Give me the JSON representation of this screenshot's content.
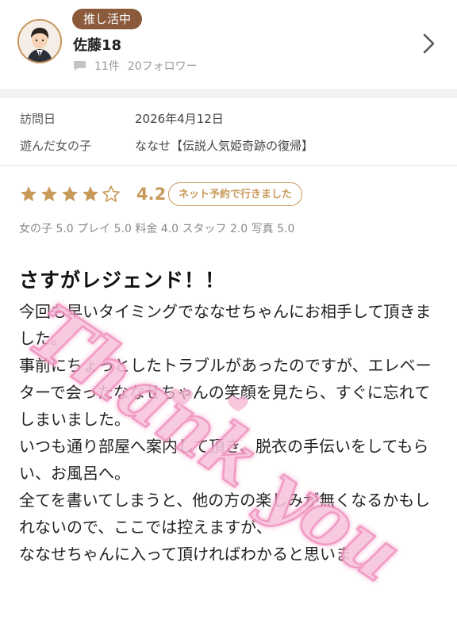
{
  "header": {
    "badge": "推し活中",
    "user_name": "佐藤18",
    "review_count": "11件",
    "followers": "20フォロワー"
  },
  "info": {
    "visit_label": "訪問日",
    "visit_date": "2026年4月12日",
    "girl_label": "遊んだ女の子",
    "girl_value": "ななせ【伝説人気姫奇跡の復帰】"
  },
  "rating": {
    "stars": 4,
    "max_stars": 5,
    "score": "4.2",
    "booking_badge": "ネット予約で行きました",
    "subscores": "女の子 5.0  プレイ 5.0  料金 4.0  スタッフ 2.0  写真 5.0"
  },
  "review": {
    "title": "さすがレジェンド！！",
    "paragraphs": [
      "今回も早いタイミングでななせちゃんにお相手して頂きました。",
      "事前にちょっとしたトラブルがあったのですが、エレベーターで会ったななせちゃんの笑顔を見たら、すぐに忘れてしまいました。",
      "いつも通り部屋へ案内して頂き、脱衣の手伝いをしてもらい、お風呂へ。",
      "全てを書いてしまうと、他の方の楽しみが無くなるかもしれないので、ここでは控えますが、",
      "ななせちゃんに入って頂ければわかると思いま"
    ]
  },
  "watermark": {
    "text": "Thank you"
  },
  "colors": {
    "accent": "#c89a5a",
    "badge_bg": "#8a5a3a",
    "watermark": "#f3a9cf"
  },
  "icons": {
    "chat": "chat-bubble-icon",
    "chevron": "chevron-right-icon",
    "star": "star-icon"
  }
}
